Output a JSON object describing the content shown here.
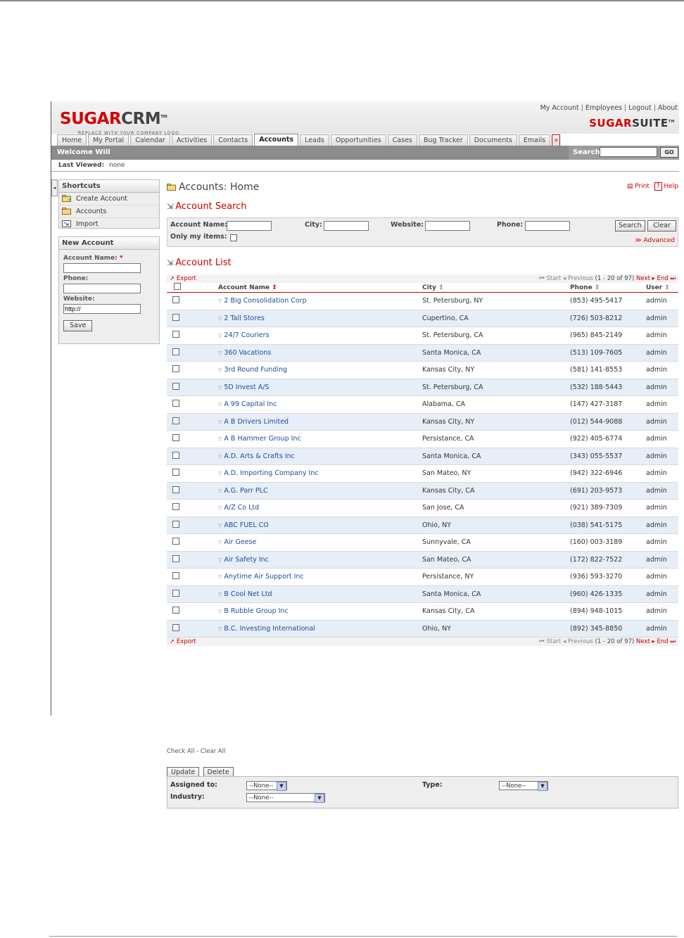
{
  "header": {
    "logo_a": "SUGAR",
    "logo_b": "CRM",
    "logo_tm": "TM",
    "logo_tagline": "REPLACE WITH YOUR COMPANY LOGO",
    "links": [
      "My Account",
      "Employees",
      "Logout",
      "About"
    ],
    "suite_a": "SUGAR",
    "suite_b": "SUITE",
    "suite_tm": "TM"
  },
  "tabs": [
    "Home",
    "My Portal",
    "Calendar",
    "Activities",
    "Contacts",
    "Accounts",
    "Leads",
    "Opportunities",
    "Cases",
    "Bug Tracker",
    "Documents",
    "Emails"
  ],
  "tabs_more": "»",
  "welcome": {
    "text": "Welcome Will",
    "search_label": "Search",
    "go_label": "GO"
  },
  "last_viewed": {
    "label": "Last Viewed:",
    "value": "none"
  },
  "shortcuts": {
    "title": "Shortcuts",
    "items": [
      "Create Account",
      "Accounts",
      "Import"
    ]
  },
  "new_account": {
    "title": "New Account",
    "name_label": "Account Name:",
    "required_mark": "*",
    "phone_label": "Phone:",
    "website_label": "Website:",
    "website_value": "http://",
    "save_label": "Save"
  },
  "page": {
    "title": "Accounts: Home",
    "print_label": "Print",
    "help_label": "Help"
  },
  "search": {
    "title": "Account Search",
    "account_name_label": "Account Name:",
    "city_label": "City:",
    "website_label": "Website:",
    "phone_label": "Phone:",
    "only_my_label": "Only my items:",
    "search_button": "Search",
    "clear_button": "Clear",
    "advanced_label": "Advanced"
  },
  "list": {
    "title": "Account List",
    "export_label": "Export",
    "pager": {
      "start": "Start",
      "previous": "Previous",
      "range": "(1 - 20 of 97)",
      "next": "Next",
      "end": "End"
    },
    "columns": [
      "Account Name",
      "City",
      "Phone",
      "User"
    ],
    "rows": [
      {
        "name": "2 Big Consolidation Corp",
        "city": "St. Petersburg, NY",
        "phone": "(853) 495-5417",
        "user": "admin"
      },
      {
        "name": "2 Tall Stores",
        "city": "Cupertino, CA",
        "phone": "(726) 503-8212",
        "user": "admin"
      },
      {
        "name": "24/7 Couriers",
        "city": "St. Petersburg, CA",
        "phone": "(965) 845-2149",
        "user": "admin"
      },
      {
        "name": "360 Vacations",
        "city": "Santa Monica, CA",
        "phone": "(513) 109-7605",
        "user": "admin"
      },
      {
        "name": "3rd Round Funding",
        "city": "Kansas City, NY",
        "phone": "(581) 141-8553",
        "user": "admin"
      },
      {
        "name": "5D Invest A/S",
        "city": "St. Petersburg, CA",
        "phone": "(532) 188-5443",
        "user": "admin"
      },
      {
        "name": "A 99 Capital Inc",
        "city": "Alabama, CA",
        "phone": "(147) 427-3187",
        "user": "admin"
      },
      {
        "name": "A B Drivers Limited",
        "city": "Kansas City, NY",
        "phone": "(012) 544-9088",
        "user": "admin"
      },
      {
        "name": "A B Hammer Group Inc",
        "city": "Persistance, CA",
        "phone": "(922) 405-6774",
        "user": "admin"
      },
      {
        "name": "A.D. Arts & Crafts Inc",
        "city": "Santa Monica, CA",
        "phone": "(343) 055-5537",
        "user": "admin"
      },
      {
        "name": "A.D. Importing Company Inc",
        "city": "San Mateo, NY",
        "phone": "(942) 322-6946",
        "user": "admin"
      },
      {
        "name": "A.G. Parr PLC",
        "city": "Kansas City, CA",
        "phone": "(691) 203-9573",
        "user": "admin"
      },
      {
        "name": "A/Z Co Ltd",
        "city": "San Jose, CA",
        "phone": "(921) 389-7309",
        "user": "admin"
      },
      {
        "name": "ABC FUEL CO",
        "city": "Ohio, NY",
        "phone": "(038) 541-5175",
        "user": "admin"
      },
      {
        "name": "Air Geese",
        "city": "Sunnyvale, CA",
        "phone": "(160) 003-3189",
        "user": "admin"
      },
      {
        "name": "Air Safety Inc",
        "city": "San Mateo, CA",
        "phone": "(172) 822-7522",
        "user": "admin"
      },
      {
        "name": "Anytime Air Support Inc",
        "city": "Persistance, NY",
        "phone": "(936) 593-3270",
        "user": "admin"
      },
      {
        "name": "B Cool Net Ltd",
        "city": "Santa Monica, CA",
        "phone": "(960) 426-1335",
        "user": "admin"
      },
      {
        "name": "B Rubble Group Inc",
        "city": "Kansas City, CA",
        "phone": "(894) 948-1015",
        "user": "admin"
      },
      {
        "name": "B.C. Investing International",
        "city": "Ohio, NY",
        "phone": "(892) 345-8850",
        "user": "admin"
      }
    ],
    "check_all": "Check All",
    "clear_all": "Clear All",
    "update_button": "Update",
    "delete_button": "Delete"
  },
  "mass_update": {
    "assigned_label": "Assigned to:",
    "assigned_value": "--None--",
    "type_label": "Type:",
    "type_value": "--None--",
    "industry_label": "Industry:",
    "industry_value": "--None--"
  },
  "colors": {
    "brand_red": "#d40000",
    "link_blue": "#224a9a",
    "row_alt": "#e6eef8",
    "bar_gray": "#8c8c8c"
  }
}
